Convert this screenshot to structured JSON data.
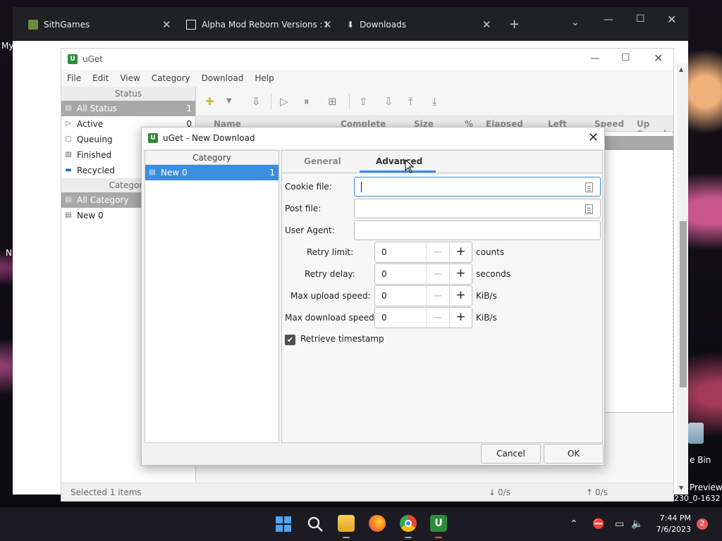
{
  "browser": {
    "tabs": [
      {
        "label": "SithGames"
      },
      {
        "label": "Alpha Mod Reborn Versions : I"
      },
      {
        "label": "Downloads"
      }
    ],
    "page_left_text": "My",
    "desktop_left_label": "N",
    "desktop_right_labels": [
      "e Bin",
      "Preview",
      "230_0-1632"
    ]
  },
  "uget": {
    "title": "uGet",
    "menu": [
      "File",
      "Edit",
      "View",
      "Category",
      "Download",
      "Help"
    ],
    "status_header": "Status",
    "status_items": [
      {
        "label": "All Status",
        "count": "1"
      },
      {
        "label": "Active",
        "count": "0"
      },
      {
        "label": "Queuing",
        "count": ""
      },
      {
        "label": "Finished",
        "count": ""
      },
      {
        "label": "Recycled",
        "count": ""
      }
    ],
    "category_header": "Category",
    "category_items": [
      {
        "label": "All Category"
      },
      {
        "label": "New 0"
      }
    ],
    "columns": [
      "Name",
      "Complete",
      "Size",
      "%",
      "Elapsed",
      "Left",
      "Speed",
      "Up Speed"
    ],
    "status_bar": {
      "selected": "Selected 1 items",
      "down_speed": "0/s",
      "up_speed": "0/s"
    }
  },
  "dialog": {
    "title": "uGet - New Download",
    "category_header": "Category",
    "category_item": {
      "label": "New 0",
      "count": "1"
    },
    "tabs": [
      {
        "label": "General",
        "active": false
      },
      {
        "label": "Advanced",
        "active": true
      }
    ],
    "fields": {
      "cookie_label": "Cookie file:",
      "post_label": "Post file:",
      "user_agent_label": "User Agent:",
      "cookie_value": "",
      "post_value": "",
      "user_agent_value": ""
    },
    "spinners": [
      {
        "label": "Retry limit:",
        "value": "0",
        "unit": "counts"
      },
      {
        "label": "Retry delay:",
        "value": "0",
        "unit": "seconds"
      },
      {
        "label": "Max upload speed:",
        "value": "0",
        "unit": "KiB/s"
      },
      {
        "label": "Max download speed:",
        "value": "0",
        "unit": "KiB/s"
      }
    ],
    "retrieve_timestamp": {
      "label": "Retrieve timestamp",
      "checked": true
    },
    "buttons": {
      "cancel": "Cancel",
      "ok": "OK"
    }
  },
  "taskbar": {
    "time": "7:44 PM",
    "date": "7/6/2023",
    "notification_count": "2"
  },
  "colors": {
    "accent": "#3b8de0",
    "selection_gray": "#a8a8a8",
    "uget_green": "#2e8b3a"
  }
}
